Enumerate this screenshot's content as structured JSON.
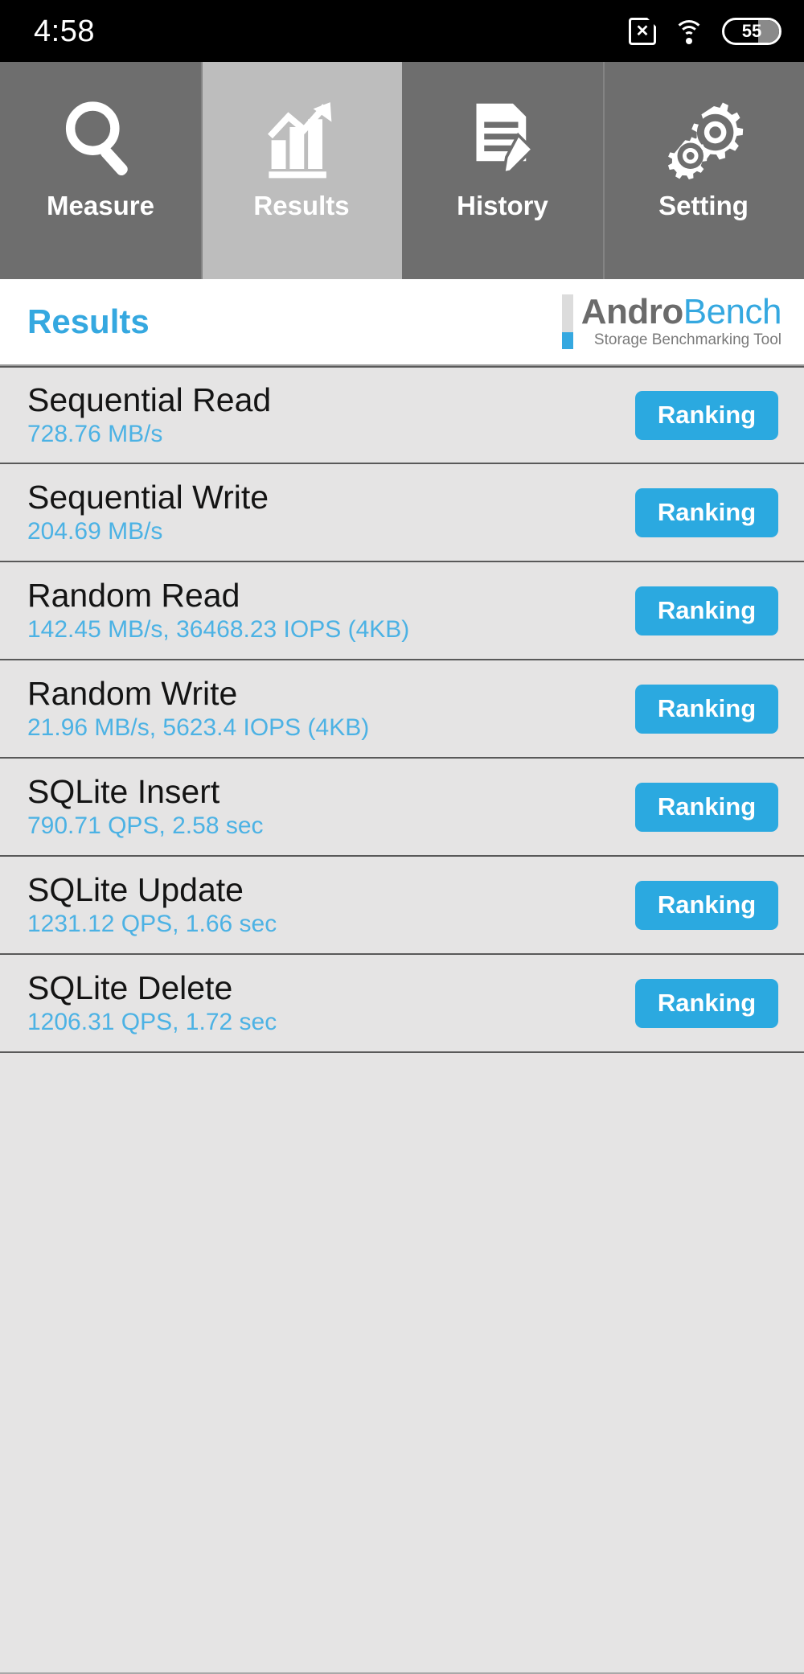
{
  "statusbar": {
    "time": "4:58",
    "battery_level": "55",
    "icons": [
      "sim-card-no-service-icon",
      "wifi-icon",
      "battery-icon"
    ]
  },
  "tabs": [
    {
      "label": "Measure",
      "icon": "magnifier-icon",
      "active": false
    },
    {
      "label": "Results",
      "icon": "bar-chart-arrow-icon",
      "active": true
    },
    {
      "label": "History",
      "icon": "document-pen-icon",
      "active": false
    },
    {
      "label": "Setting",
      "icon": "gears-icon",
      "active": false
    }
  ],
  "header": {
    "title": "Results",
    "logo_primary": "Andro",
    "logo_secondary": "Bench",
    "logo_subtitle": "Storage Benchmarking Tool"
  },
  "colors": {
    "accent_blue": "#2ba9e0",
    "value_blue": "#4cb2e4",
    "title_blue": "#35a8e0",
    "list_bg": "#e5e4e4",
    "tab_bg": "#6e6e6e",
    "tab_active_bg": "#bdbdbd"
  },
  "results": [
    {
      "name": "Sequential Read",
      "value": "728.76 MB/s",
      "action": "Ranking"
    },
    {
      "name": "Sequential Write",
      "value": "204.69 MB/s",
      "action": "Ranking"
    },
    {
      "name": "Random Read",
      "value": "142.45 MB/s, 36468.23 IOPS (4KB)",
      "action": "Ranking"
    },
    {
      "name": "Random Write",
      "value": "21.96 MB/s, 5623.4 IOPS (4KB)",
      "action": "Ranking"
    },
    {
      "name": "SQLite Insert",
      "value": "790.71 QPS, 2.58 sec",
      "action": "Ranking"
    },
    {
      "name": "SQLite Update",
      "value": "1231.12 QPS, 1.66 sec",
      "action": "Ranking"
    },
    {
      "name": "SQLite Delete",
      "value": "1206.31 QPS, 1.72 sec",
      "action": "Ranking"
    }
  ]
}
